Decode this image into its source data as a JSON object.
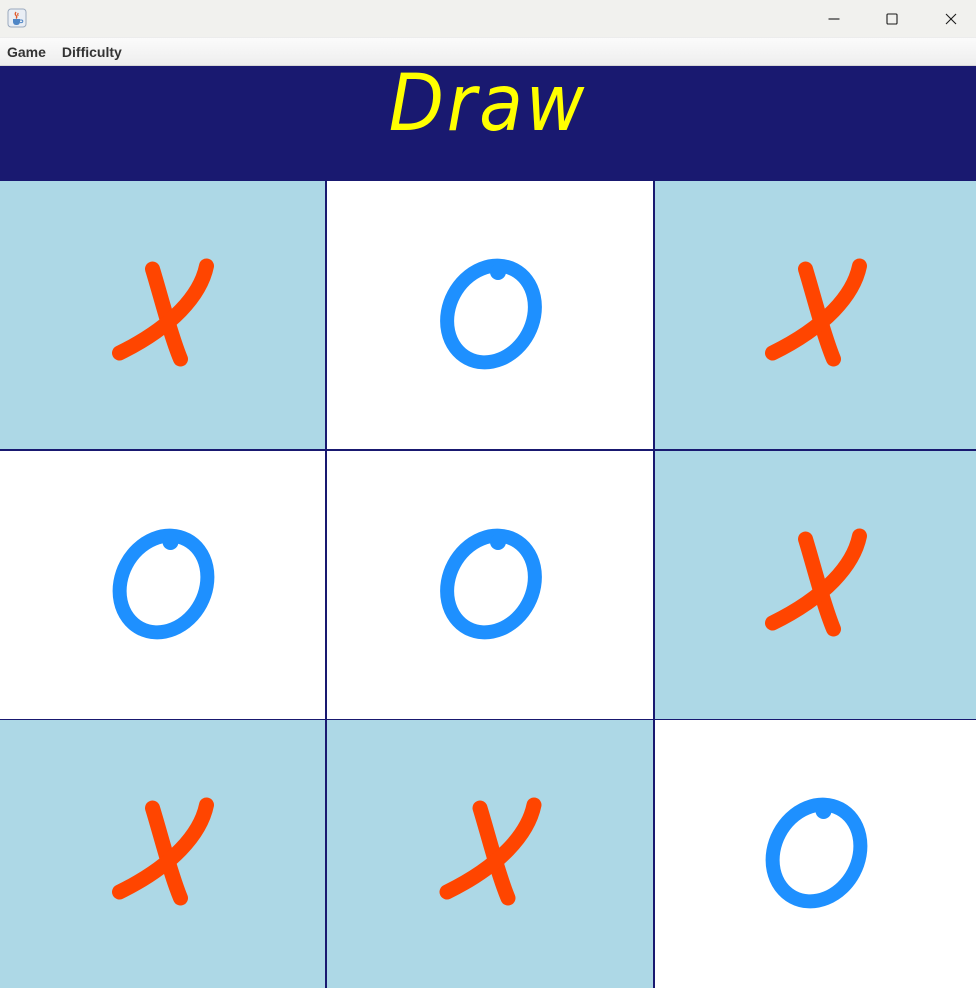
{
  "window": {
    "title": "",
    "controls": {
      "minimize_icon": "minimize-icon",
      "maximize_icon": "maximize-icon",
      "close_icon": "close-icon"
    },
    "app_icon": "java-cup-icon"
  },
  "menubar": {
    "items": [
      {
        "label": "Game"
      },
      {
        "label": "Difficulty"
      }
    ]
  },
  "status": {
    "text": "Draw",
    "color": "#ffff00",
    "background": "#191970"
  },
  "board": {
    "rows": 3,
    "cols": 3,
    "cells": [
      [
        "X",
        "O",
        "X"
      ],
      [
        "O",
        "O",
        "X"
      ],
      [
        "X",
        "X",
        "O"
      ]
    ],
    "colors": {
      "x_mark": "#ff4500",
      "o_mark": "#1e90ff",
      "x_cell_bg": "#add8e6",
      "o_cell_bg": "#ffffff",
      "grid_line": "#191970"
    }
  }
}
